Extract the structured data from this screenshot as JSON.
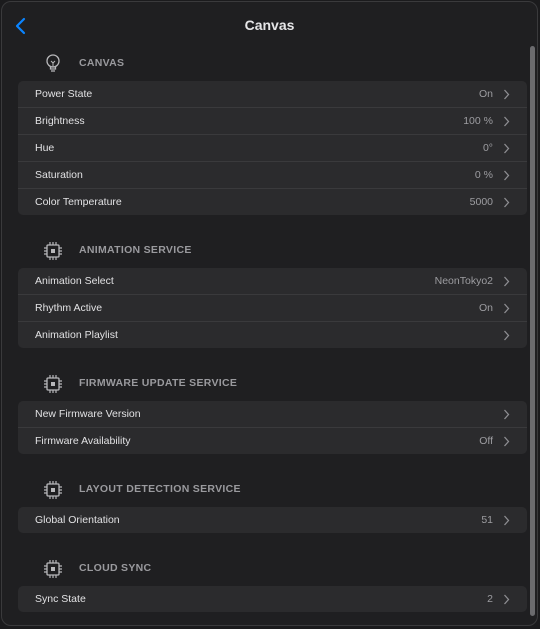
{
  "header": {
    "title": "Canvas"
  },
  "colors": {
    "accent": "#0a84ff",
    "background": "#1f1f21",
    "row_background": "#2b2b2d"
  },
  "sections": [
    {
      "label": "CANVAS",
      "icon": "lightbulb-icon",
      "rows": [
        {
          "label": "Power State",
          "value": "On"
        },
        {
          "label": "Brightness",
          "value": "100 %"
        },
        {
          "label": "Hue",
          "value": "0°"
        },
        {
          "label": "Saturation",
          "value": "0 %"
        },
        {
          "label": "Color Temperature",
          "value": "5000"
        }
      ]
    },
    {
      "label": "ANIMATION SERVICE",
      "icon": "chip-icon",
      "rows": [
        {
          "label": "Animation Select",
          "value": "NeonTokyo2"
        },
        {
          "label": "Rhythm Active",
          "value": "On"
        },
        {
          "label": "Animation Playlist",
          "value": ""
        }
      ]
    },
    {
      "label": "FIRMWARE UPDATE SERVICE",
      "icon": "chip-icon",
      "rows": [
        {
          "label": "New Firmware Version",
          "value": ""
        },
        {
          "label": "Firmware Availability",
          "value": "Off"
        }
      ]
    },
    {
      "label": "LAYOUT DETECTION SERVICE",
      "icon": "chip-icon",
      "rows": [
        {
          "label": "Global Orientation",
          "value": "51"
        }
      ]
    },
    {
      "label": "CLOUD SYNC",
      "icon": "chip-icon",
      "rows": [
        {
          "label": "Sync State",
          "value": "2"
        }
      ]
    }
  ]
}
